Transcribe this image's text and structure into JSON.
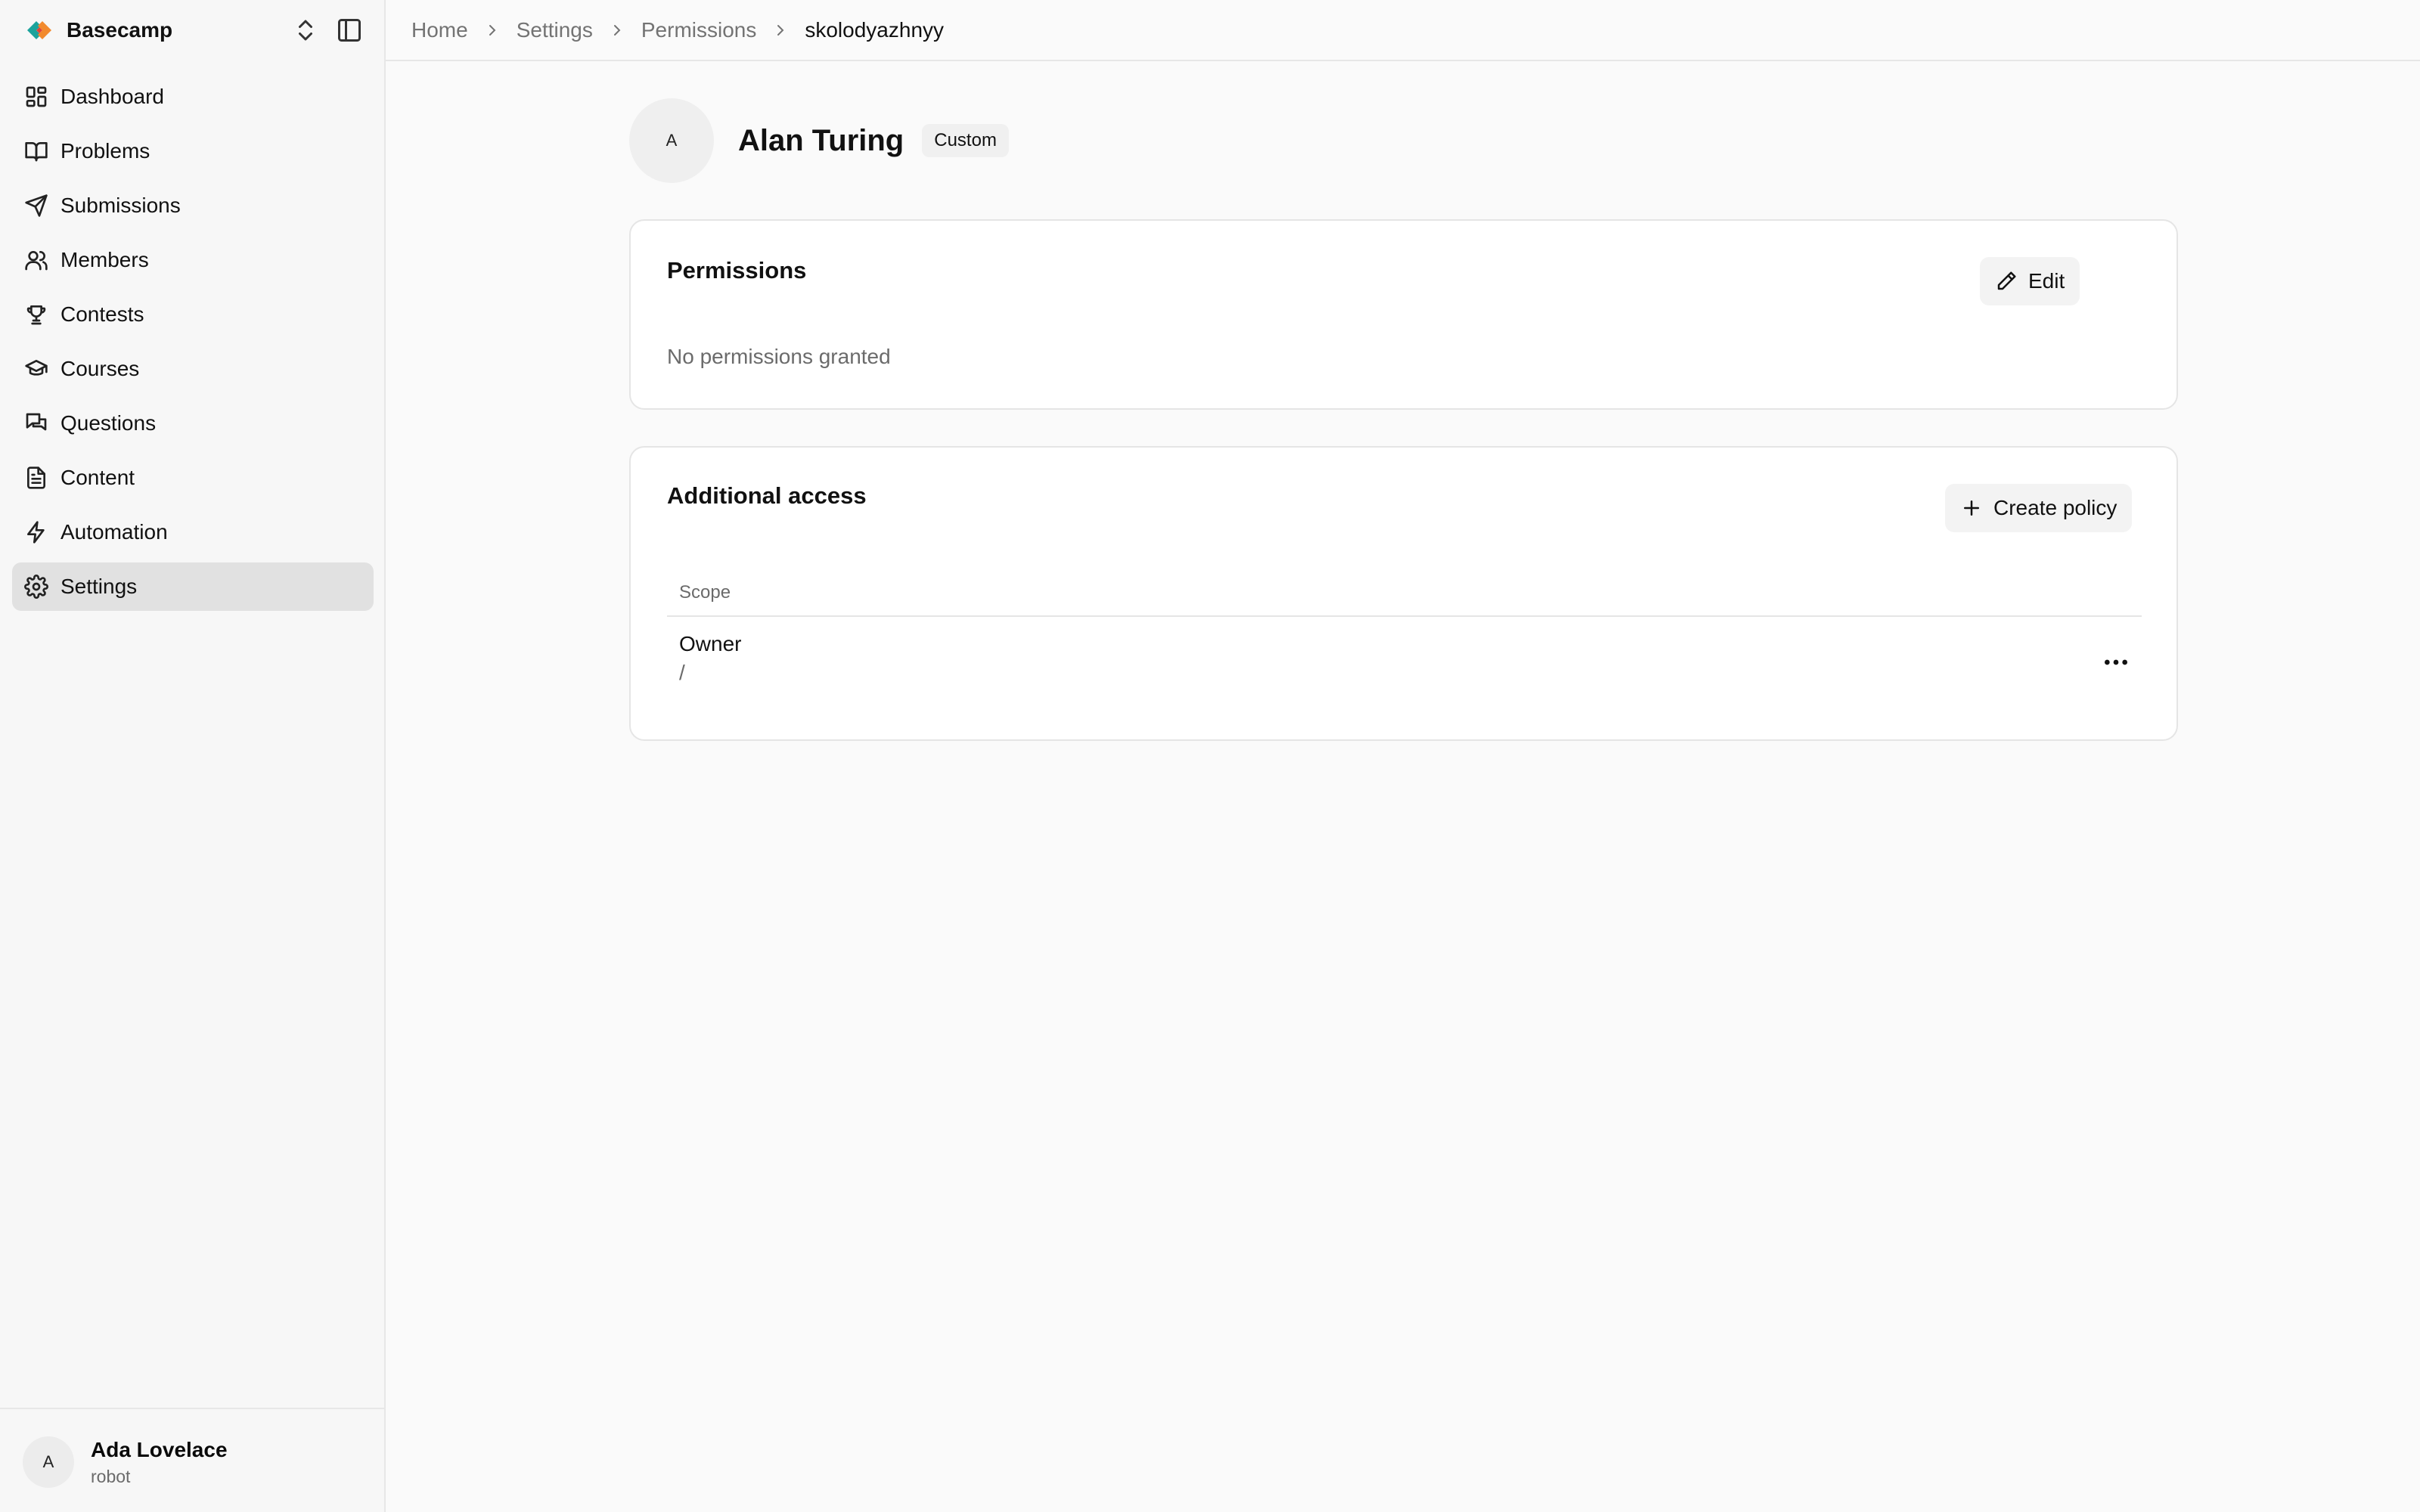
{
  "sidebar": {
    "brand": "Basecamp",
    "items": [
      {
        "label": "Dashboard",
        "icon": "dashboard-icon"
      },
      {
        "label": "Problems",
        "icon": "book-icon"
      },
      {
        "label": "Submissions",
        "icon": "send-icon"
      },
      {
        "label": "Members",
        "icon": "users-icon"
      },
      {
        "label": "Contests",
        "icon": "trophy-icon"
      },
      {
        "label": "Courses",
        "icon": "graduation-cap-icon"
      },
      {
        "label": "Questions",
        "icon": "messages-icon"
      },
      {
        "label": "Content",
        "icon": "file-text-icon"
      },
      {
        "label": "Automation",
        "icon": "lightning-icon"
      },
      {
        "label": "Settings",
        "icon": "gear-icon",
        "active": true
      }
    ],
    "user": {
      "initial": "A",
      "name": "Ada Lovelace",
      "role": "robot"
    }
  },
  "breadcrumb": [
    "Home",
    "Settings",
    "Permissions",
    "skolodyazhnyy"
  ],
  "profile": {
    "initial": "A",
    "name": "Alan Turing",
    "badge": "Custom"
  },
  "permissions": {
    "title": "Permissions",
    "edit_label": "Edit",
    "empty_text": "No permissions granted"
  },
  "additional_access": {
    "title": "Additional access",
    "create_label": "Create policy",
    "columns": [
      "Scope"
    ],
    "rows": [
      {
        "title": "Owner",
        "path": "/"
      }
    ]
  },
  "colors": {
    "background": "#fafafa",
    "sidebar": "#f7f7f7",
    "active_item": "#e1e1e1",
    "logo_orange": "#f28a2e",
    "logo_teal": "#1ba39c"
  }
}
